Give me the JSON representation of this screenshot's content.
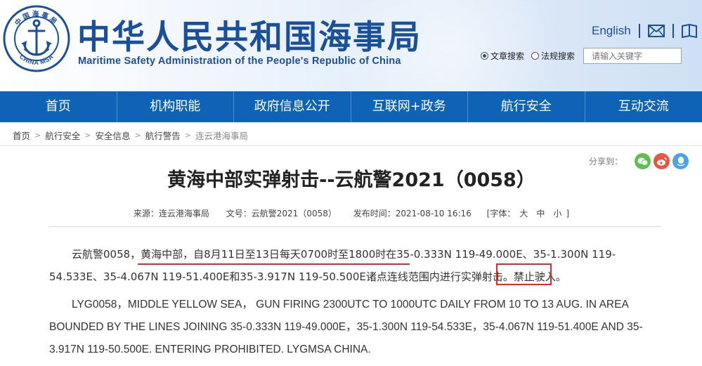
{
  "header": {
    "title_cn": "中华人民共和国海事局",
    "title_en": "Maritime Safety Administration of the People's Republic of China",
    "logo_top_text": "中国海事局",
    "logo_bottom_text": "CHINA MSA",
    "lang_link": "English",
    "search": {
      "options": [
        "文章搜索",
        "法规搜索"
      ],
      "selected": "文章搜索",
      "placeholder": "请输入关键字"
    }
  },
  "nav": {
    "items": [
      "首页",
      "机构职能",
      "政府信息公开",
      "互联网+政务",
      "航行安全",
      "互动交流"
    ]
  },
  "breadcrumb": {
    "items": [
      "首页",
      "航行安全",
      "安全信息",
      "航行警告",
      "连云港海事局"
    ],
    "separator": ">"
  },
  "share": {
    "label": "分享到："
  },
  "article": {
    "title": "黄海中部实弹射击--云航警2021（0058）",
    "meta": {
      "source": "来源：连云港海事局",
      "doc_no": "文号：云航警2021（0058）",
      "publish_time": "发布时间：2021-08-10 16:16",
      "font_size_label": "[字体：",
      "font_sizes": [
        "大",
        "中",
        "小"
      ],
      "font_size_end": "]"
    },
    "para_cn": "云航警0058，黄海中部，自8月11日至13日每天0700时至1800时在35-0.333N 119-49.000E、35-1.300N 119-54.533E、35-4.067N 119-51.400E和35-3.917N 119-50.500E诸点连线范围内进行实弹射击。禁止驶入。",
    "para_en": "LYG0058，MIDDLE YELLOW SEA， GUN FIRING 2300UTC TO 1000UTC DAILY FROM 10 TO 13 AUG. IN AREA BOUNDED BY THE LINES JOINING 35-0.333N 119-49.000E，35-1.300N 119-54.533E，35-4.067N 119-51.400E AND 35-3.917N 119-50.500E. ENTERING PROHIBITED. LYGMSA CHINA."
  },
  "colors": {
    "brand_blue": "#1a4f9c",
    "nav_blue": "#0f63b6",
    "annotation_red": "#e02b2b",
    "wechat_green": "#5cc04b",
    "weibo_red": "#e8563f",
    "qq_blue": "#4aa3e8"
  },
  "icons": [
    "msa-logo",
    "mail-icon",
    "book-icon",
    "wechat-icon",
    "weibo-icon",
    "qq-icon"
  ]
}
